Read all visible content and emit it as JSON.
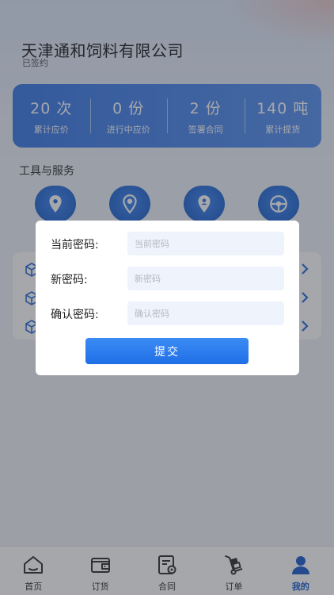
{
  "header": {
    "company_name": "天津通和饲料有限公司",
    "contract_status": "已签约"
  },
  "stats": [
    {
      "value": "20 次",
      "label": "累计应价"
    },
    {
      "value": "0 份",
      "label": "进行中应价"
    },
    {
      "value": "2 份",
      "label": "签署合同"
    },
    {
      "value": "140 吨",
      "label": "累计提货"
    }
  ],
  "tools": {
    "section_title": "工具与服务",
    "icons": [
      "location-pin-icon",
      "map-marker-icon",
      "user-location-icon",
      "steering-wheel-icon"
    ]
  },
  "password_modal": {
    "current_label": "当前密码:",
    "current_placeholder": "当前密码",
    "new_label": "新密码:",
    "new_placeholder": "新密码",
    "confirm_label": "确认密码:",
    "confirm_placeholder": "确认密码",
    "submit_label": "提交"
  },
  "tabbar": {
    "items": [
      {
        "label": "首页",
        "icon": "home-icon",
        "active": false
      },
      {
        "label": "订货",
        "icon": "wallet-icon",
        "active": false
      },
      {
        "label": "合同",
        "icon": "contract-icon",
        "active": false
      },
      {
        "label": "订单",
        "icon": "hand-truck-icon",
        "active": false
      },
      {
        "label": "我的",
        "icon": "user-icon",
        "active": true
      }
    ]
  },
  "colors": {
    "primary": "#1f6fe6",
    "card_gradient_start": "#3f7be6",
    "active_tab": "#1f5fcf"
  }
}
